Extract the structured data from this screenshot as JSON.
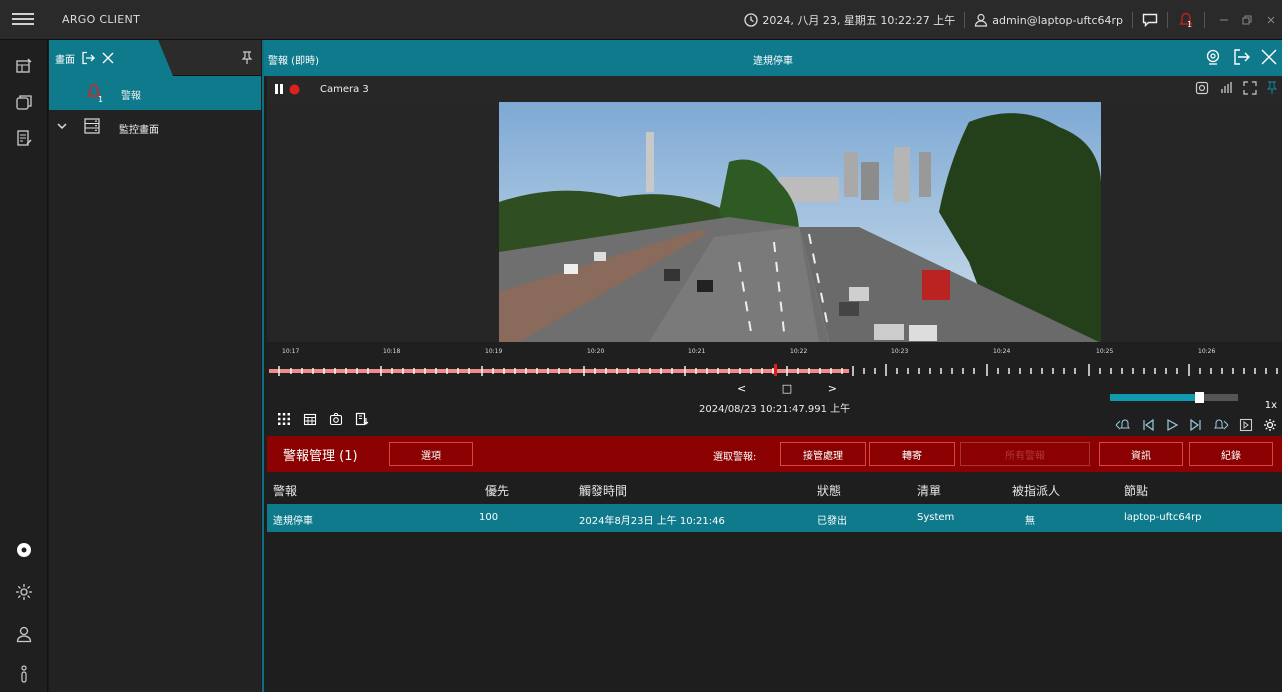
{
  "app": {
    "title": "ARGO CLIENT"
  },
  "topbar": {
    "datetime": "2024, 八月 23, 星期五 10:22:27 上午",
    "user": "admin@laptop-uftc64rp",
    "alarm_badge": "1",
    "icons": [
      "clock-icon",
      "user-icon",
      "chat-icon",
      "alarm-bell-icon",
      "minimize-icon",
      "restore-icon",
      "close-icon"
    ]
  },
  "left_rail": {
    "top_icons": [
      "monitor-layout-icon",
      "window-icon",
      "document-edit-icon"
    ],
    "bottom_icons": [
      "settings-active-icon",
      "settings-icon",
      "user-icon",
      "info-icon"
    ]
  },
  "sidebar": {
    "tab_label": "畫面",
    "items": [
      {
        "label": "警報",
        "badge": "1",
        "icon": "bell-icon"
      },
      {
        "label": "監控畫面",
        "icon": "server-icon"
      }
    ]
  },
  "panel": {
    "title_left": "警報 (即時)",
    "title_center": "違規停車"
  },
  "video": {
    "camera_name": "Camera 3",
    "timestamp": "2024/08/23 10:21:47.991 上午",
    "speed": "1x",
    "speed_fill": 0.7,
    "time_labels": [
      "10:17",
      "10:18",
      "10:19",
      "10:20",
      "10:21",
      "10:22",
      "10:23",
      "10:24",
      "10:25",
      "10:26"
    ]
  },
  "alarm_bar": {
    "title": "警報管理 (1)",
    "options_label": "選項",
    "select_label": "選取警報:",
    "btn_takeover": "接管處理",
    "btn_forward": "轉寄",
    "btn_disabled": "所有警報",
    "btn_info": "資訊",
    "btn_log": "紀錄"
  },
  "table": {
    "headers": [
      "警報",
      "優先",
      "觸發時間",
      "狀態",
      "清單",
      "被指派人",
      "節點"
    ],
    "rows": [
      [
        "違規停車",
        "100",
        "2024年8月23日 上午 10:21:46",
        "已發出",
        "System",
        "無",
        "laptop-uftc64rp"
      ]
    ]
  },
  "colors": {
    "accent": "#0f7a8c",
    "alarm": "#8b0000",
    "record": "#e02020"
  }
}
